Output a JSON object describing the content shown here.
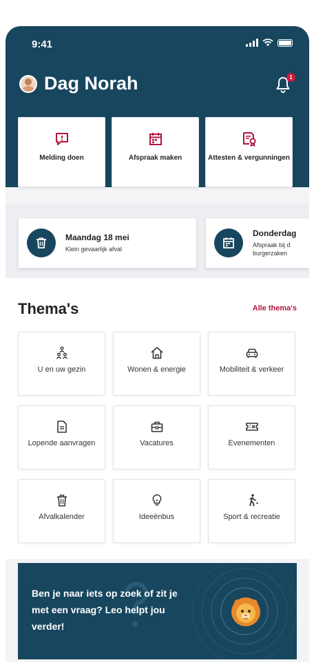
{
  "status_bar": {
    "time": "9:41"
  },
  "header": {
    "greeting": "Dag Norah",
    "notification_count": "1"
  },
  "quick_actions": [
    {
      "label": "Melding doen",
      "icon": "alert-message-icon"
    },
    {
      "label": "Afspraak maken",
      "icon": "calendar-icon"
    },
    {
      "label": "Attesten & vergunningen",
      "icon": "certificate-icon"
    }
  ],
  "agenda": [
    {
      "title": "Maandag 18 mei",
      "subtitle": "Klein gevaarlijk afval",
      "icon": "trash-icon"
    },
    {
      "title": "Donderdag",
      "subtitle": "Afspraak bij d burgerzaken",
      "icon": "calendar-icon"
    }
  ],
  "themes": {
    "title": "Thema's",
    "link": "Alle thema's",
    "items": [
      {
        "label": "U en uw gezin",
        "icon": "family-icon"
      },
      {
        "label": "Wonen & energie",
        "icon": "house-icon"
      },
      {
        "label": "Mobiliteit & verkeer",
        "icon": "car-icon"
      },
      {
        "label": "Lopende aanvragen",
        "icon": "document-icon"
      },
      {
        "label": "Vacatures",
        "icon": "briefcase-icon"
      },
      {
        "label": "Evenementen",
        "icon": "ticket-icon"
      },
      {
        "label": "Afvalkalender",
        "icon": "trash-icon"
      },
      {
        "label": "Ideeënbus",
        "icon": "lightbulb-icon"
      },
      {
        "label": "Sport & recreatie",
        "icon": "walking-icon"
      }
    ]
  },
  "banner": {
    "text": "Ben je naar iets op zoek of zit je met een vraag? Leo helpt jou verder!"
  },
  "colors": {
    "primary": "#17465e",
    "accent": "#b0163c",
    "badge": "#d0193d"
  }
}
